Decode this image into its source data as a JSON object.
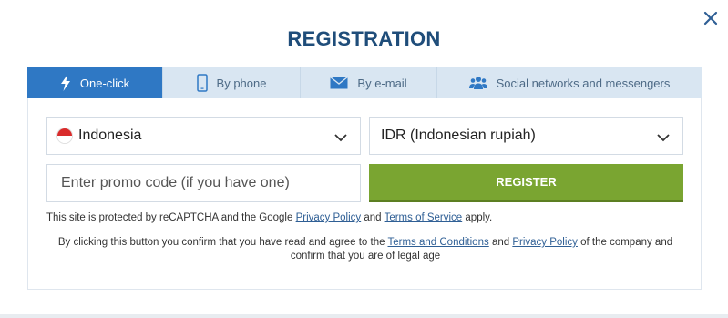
{
  "modal": {
    "title": "REGISTRATION",
    "close_icon": "close-icon"
  },
  "tabs": [
    {
      "label": "One-click",
      "icon": "lightning-icon",
      "active": true
    },
    {
      "label": "By phone",
      "icon": "phone-icon",
      "active": false
    },
    {
      "label": "By e-mail",
      "icon": "envelope-icon",
      "active": false
    },
    {
      "label": "Social networks and messengers",
      "icon": "people-icon",
      "active": false
    }
  ],
  "form": {
    "country": {
      "value": "Indonesia",
      "flag": "indonesia-flag-icon"
    },
    "currency": {
      "value": "IDR (Indonesian rupiah)"
    },
    "promo": {
      "placeholder": "Enter promo code (if you have one)"
    },
    "register_label": "REGISTER"
  },
  "notes": {
    "recaptcha_prefix": "This site is protected by reCAPTCHA and the Google",
    "privacy_policy": "Privacy Policy",
    "and": "and",
    "terms_of_service": "Terms of Service",
    "apply": "apply.",
    "confirm_prefix": "By clicking this button you confirm that you have read and agree to the",
    "terms_and_conditions": "Terms and Conditions",
    "and2": "and",
    "privacy_policy2": "Privacy Policy",
    "confirm_suffix": "of the company and confirm that you are of legal age"
  },
  "colors": {
    "accent": "#2f78c4",
    "title": "#1f4d7a",
    "register": "#7aa531",
    "tab_bg": "#d9e6f2"
  }
}
